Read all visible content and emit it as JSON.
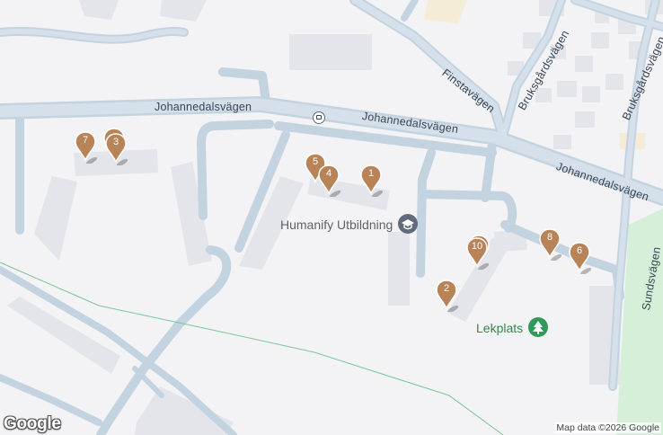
{
  "map": {
    "roads": [
      {
        "id": "johannedalsvagen-w",
        "name": "Johannedalsvägen"
      },
      {
        "id": "johannedalsvagen-c",
        "name": "Johannedalsvägen"
      },
      {
        "id": "johannedalsvagen-e",
        "name": "Johannedalsvägen"
      },
      {
        "id": "finstavagen",
        "name": "Finstavägen"
      },
      {
        "id": "bruksgardsvagen-1",
        "name": "Bruksgårdsvägen"
      },
      {
        "id": "bruksgardsvagen-2",
        "name": "Bruksgårdsvägen"
      },
      {
        "id": "sundsvagen",
        "name": "Sundsvägen"
      }
    ],
    "pois": [
      {
        "id": "humanify",
        "name": "Humanify Utbildning",
        "icon": "school-icon",
        "color": "#5f6b7a"
      },
      {
        "id": "lekplats",
        "name": "Lekplats",
        "icon": "tree-icon",
        "color": "#2e9b5a"
      }
    ],
    "markers": [
      {
        "label": "1"
      },
      {
        "label": "2"
      },
      {
        "label": "3"
      },
      {
        "label": "4"
      },
      {
        "label": "5"
      },
      {
        "label": "6"
      },
      {
        "label": "7"
      },
      {
        "label": "8"
      },
      {
        "label": "10"
      }
    ],
    "marker_color": "#b98358",
    "transit_icon": "bus-stop-icon",
    "logo": "Google",
    "attribution": "Map data ©2026 Google"
  }
}
